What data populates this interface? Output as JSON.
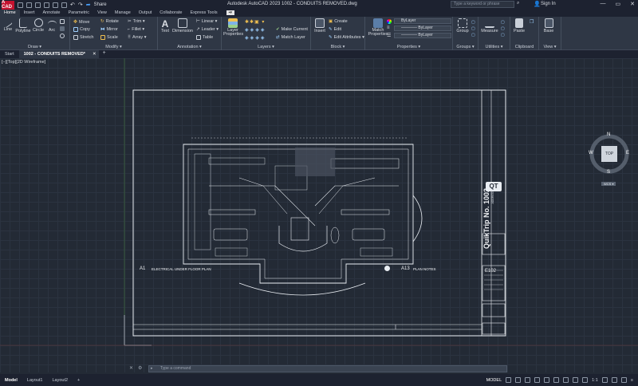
{
  "app": {
    "logo": "A CAD",
    "title": "Autodesk AutoCAD 2023   1002 - CONDUITS REMOVED.dwg",
    "share": "Share"
  },
  "search": {
    "placeholder": "Type a keyword or phrase"
  },
  "account": {
    "signin": "Sign In"
  },
  "ribbon_tabs": [
    "Home",
    "Insert",
    "Annotate",
    "Parametric",
    "View",
    "Manage",
    "Output",
    "Collaborate",
    "Express Tools"
  ],
  "ribbon": {
    "draw": {
      "title": "Draw ▾",
      "line": "Line",
      "polyline": "Polyline",
      "circle": "Circle",
      "arc": "Arc"
    },
    "modify": {
      "title": "Modify ▾",
      "move": "Move",
      "rotate": "Rotate",
      "trim": "Trim ▾",
      "copy": "Copy",
      "mirror": "Mirror",
      "fillet": "Fillet ▾",
      "stretch": "Stretch",
      "scale": "Scale",
      "array": "Array ▾"
    },
    "annotation": {
      "title": "Annotation ▾",
      "text": "Text",
      "dimension": "Dimension",
      "linear": "Linear ▾",
      "leader": "Leader ▾",
      "table": "Table"
    },
    "layers": {
      "title": "Layers ▾",
      "layer_props": "Layer Properties",
      "make_current": "Make Current",
      "match_layer": "Match Layer"
    },
    "block": {
      "title": "Block ▾",
      "insert": "Insert",
      "create": "Create",
      "edit": "Edit",
      "edit_attr": "Edit Attributes ▾"
    },
    "properties": {
      "title": "Properties ▾",
      "match": "Match Properties",
      "color": "ByLayer",
      "linetype": "———— ByLayer",
      "lineweight": "———— ByLayer"
    },
    "groups": {
      "title": "Groups ▾",
      "group": "Group"
    },
    "utilities": {
      "title": "Utilities ▾",
      "measure": "Measure"
    },
    "clipboard": {
      "title": "Clipboard",
      "paste": "Paste"
    },
    "view": {
      "title": "View ▾",
      "base": "Base"
    }
  },
  "doc_tabs": [
    "Start",
    "1002 - CONDUITS REMOVED*"
  ],
  "viewport": {
    "label": "[−][Top][2D Wireframe]"
  },
  "drawing": {
    "sheet_number": "E102",
    "project_title": "QuikTrip No. 1002",
    "project_sub": "ADDRESS",
    "logo": "QT",
    "view1_num": "A1",
    "view1_title": "ELECTRICAL UNDER FLOOR PLAN",
    "view2_num": "A13",
    "view2_title": "PLAN NOTES"
  },
  "navcube": {
    "n": "N",
    "s": "S",
    "e": "E",
    "w": "W",
    "face": "TOP",
    "wcs": "WCS ▾"
  },
  "command": {
    "placeholder": "Type a command"
  },
  "layout_tabs": [
    "Model",
    "Layout1",
    "Layout2"
  ],
  "status": {
    "model": "MODEL",
    "scale": "1:1"
  }
}
